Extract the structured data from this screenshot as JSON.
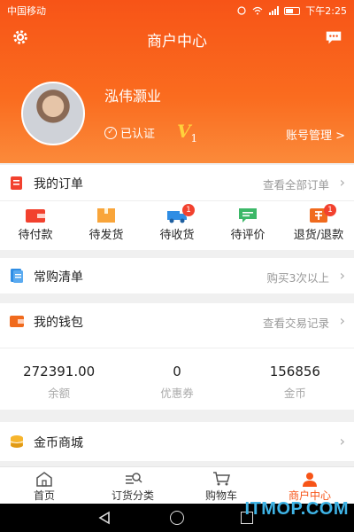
{
  "status_bar": {
    "carrier": "中国移动",
    "time": "下午2:25"
  },
  "header": {
    "title": "商户中心",
    "shop_name": "泓伟灏业",
    "certified": "已认证",
    "vip_mark": "V",
    "vip_level": "1",
    "account_manage": "账号管理 >"
  },
  "my_orders": {
    "label": "我的订单",
    "view_all": "查看全部订单",
    "items": [
      {
        "label": "待付款",
        "icon": "wallet-icon",
        "badge": ""
      },
      {
        "label": "待发货",
        "icon": "box-icon",
        "badge": ""
      },
      {
        "label": "待收货",
        "icon": "truck-icon",
        "badge": "1"
      },
      {
        "label": "待评价",
        "icon": "comment-icon",
        "badge": ""
      },
      {
        "label": "退货/退款",
        "icon": "refund-icon",
        "badge": "1"
      }
    ]
  },
  "frequent_list": {
    "label": "常购清单",
    "hint": "购买3次以上"
  },
  "my_wallet": {
    "label": "我的钱包",
    "view_records": "查看交易记录",
    "stats": [
      {
        "value": "272391.00",
        "label": "余额"
      },
      {
        "value": "0",
        "label": "优惠券"
      },
      {
        "value": "156856",
        "label": "金币"
      }
    ]
  },
  "coin_mall": {
    "label": "金币商城"
  },
  "tabbar": {
    "items": [
      {
        "label": "首页",
        "icon": "home-icon"
      },
      {
        "label": "订货分类",
        "icon": "category-search-icon"
      },
      {
        "label": "购物车",
        "icon": "cart-icon"
      },
      {
        "label": "商户中心",
        "icon": "user-icon"
      }
    ]
  },
  "watermark": "ITMOP.COM",
  "colors": {
    "accent": "#f75417",
    "badge": "#f2412e",
    "vip": "#ffd23c"
  }
}
